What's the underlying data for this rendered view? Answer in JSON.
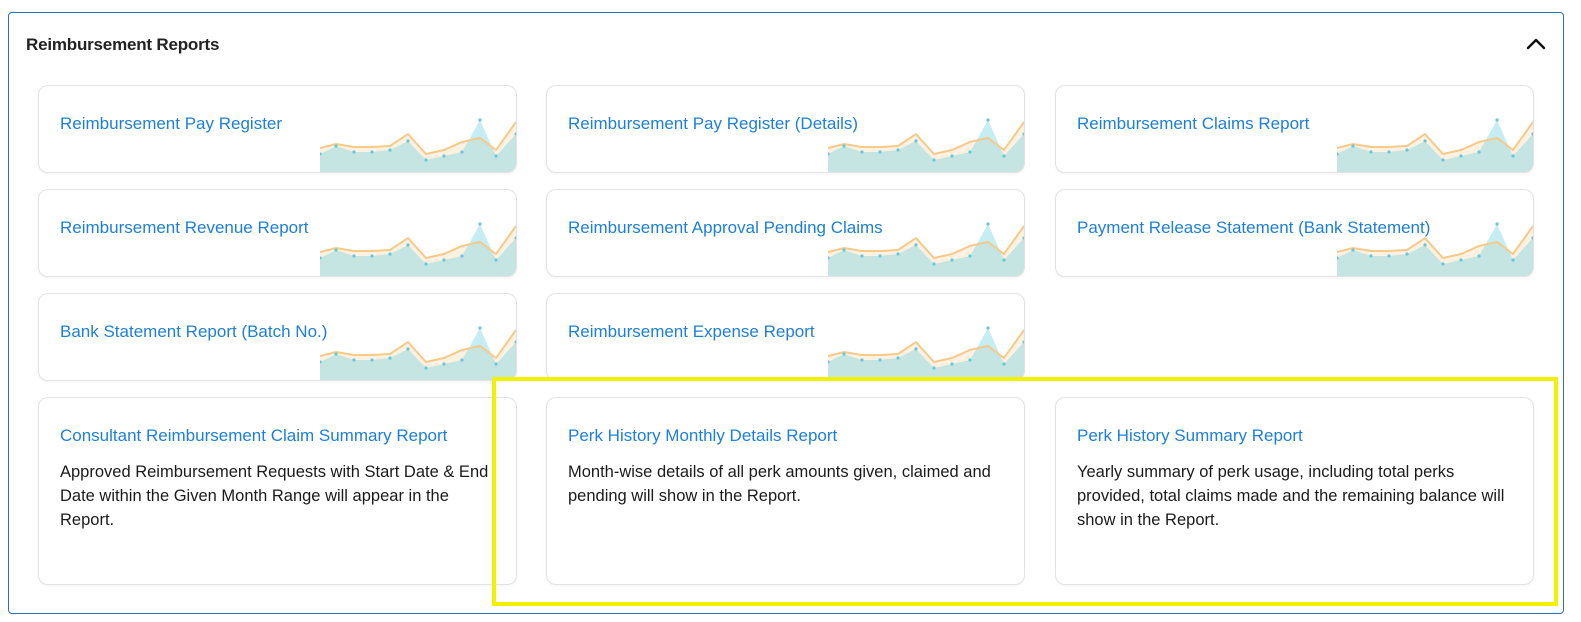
{
  "section": {
    "title": "Reimbursement Reports",
    "collapse_icon": "chevron-up-icon"
  },
  "reports": [
    {
      "title": "Reimbursement Pay Register"
    },
    {
      "title": "Reimbursement Pay Register (Details)"
    },
    {
      "title": "Reimbursement Claims Report"
    },
    {
      "title": "Reimbursement Revenue Report"
    },
    {
      "title": "Reimbursement Approval Pending Claims"
    },
    {
      "title": "Payment Release Statement (Bank Statement)"
    },
    {
      "title": "Bank Statement Report (Batch No.)"
    },
    {
      "title": "Reimbursement Expense Report"
    },
    {
      "title": "Consultant Reimbursement Claim Summary Report",
      "description": "Approved Reimbursement Requests with Start Date & End Date within the Given Month Range will appear in the Report."
    },
    {
      "title": "Perk History Monthly Details Report",
      "description": "Month-wise details of all perk amounts given, claimed and pending will show in the Report."
    },
    {
      "title": "Perk History Summary Report",
      "description": "Yearly summary of perk usage, including total perks provided, total claims made and the remaining balance will show in the Report."
    }
  ],
  "colors": {
    "title_link": "#1e7fd9",
    "panel_border": "#2f6fb4",
    "highlight": "#f2f200",
    "spark_teal": "#7fd6e3",
    "spark_orange": "#f7c98a"
  }
}
